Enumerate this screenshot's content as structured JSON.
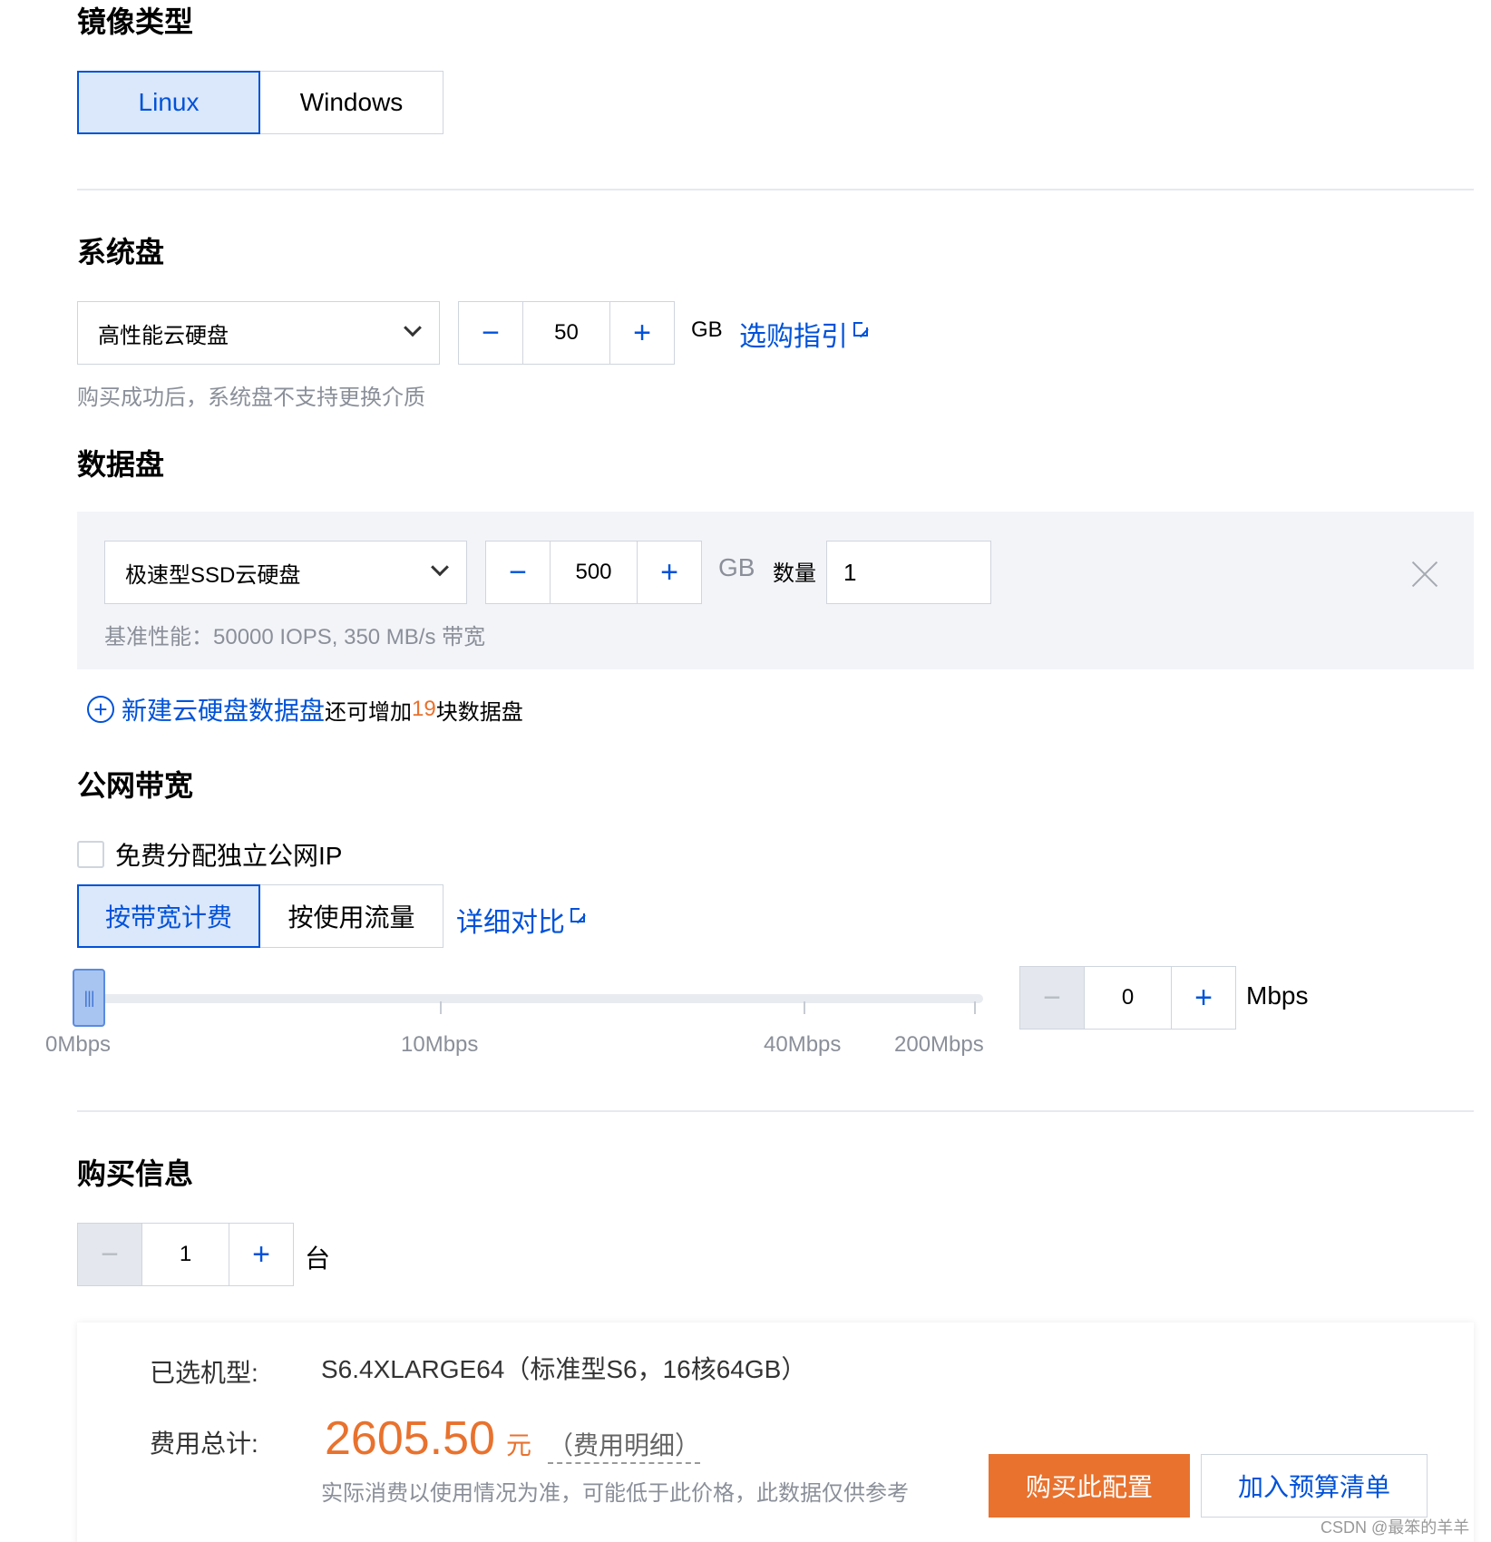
{
  "image_type": {
    "title": "镜像类型",
    "options": [
      "Linux",
      "Windows"
    ],
    "selected": "Linux"
  },
  "system_disk": {
    "title": "系统盘",
    "type": "高性能云硬盘",
    "size": "50",
    "unit": "GB",
    "guide_link": "选购指引",
    "note": "购买成功后，系统盘不支持更换介质"
  },
  "data_disk": {
    "title": "数据盘",
    "type": "极速型SSD云硬盘",
    "size": "500",
    "unit": "GB",
    "quantity_label": "数量",
    "quantity": "1",
    "perf_note": "基准性能：50000 IOPS, 350 MB/s 带宽",
    "add_link": "新建云硬盘数据盘",
    "add_note_prefix": "还可增加",
    "add_remaining": "19",
    "add_note_suffix": "块数据盘"
  },
  "bandwidth": {
    "title": "公网带宽",
    "free_ip_label": "免费分配独立公网IP",
    "free_ip_checked": false,
    "billing_options": [
      "按带宽计费",
      "按使用流量"
    ],
    "billing_selected": "按带宽计费",
    "compare_link": "详细对比",
    "slider_ticks": [
      "0Mbps",
      "10Mbps",
      "40Mbps",
      "200Mbps"
    ],
    "value": "0",
    "unit": "Mbps"
  },
  "purchase": {
    "title": "购买信息",
    "count": "1",
    "count_unit": "台",
    "selected_model_label": "已选机型:",
    "selected_model": "S6.4XLARGE64（标准型S6，16核64GB）",
    "total_label": "费用总计:",
    "price": "2605.50",
    "currency": "元",
    "detail_link": "（费用明细）",
    "price_note": "实际消费以使用情况为准，可能低于此价格，此数据仅供参考",
    "buy_button": "购买此配置",
    "budget_button": "加入预算清单"
  },
  "watermark": "CSDN @最笨的羊羊",
  "colors": {
    "accent": "#0052d9",
    "orange": "#e8722e",
    "selected_bg": "#dbe7fa"
  }
}
